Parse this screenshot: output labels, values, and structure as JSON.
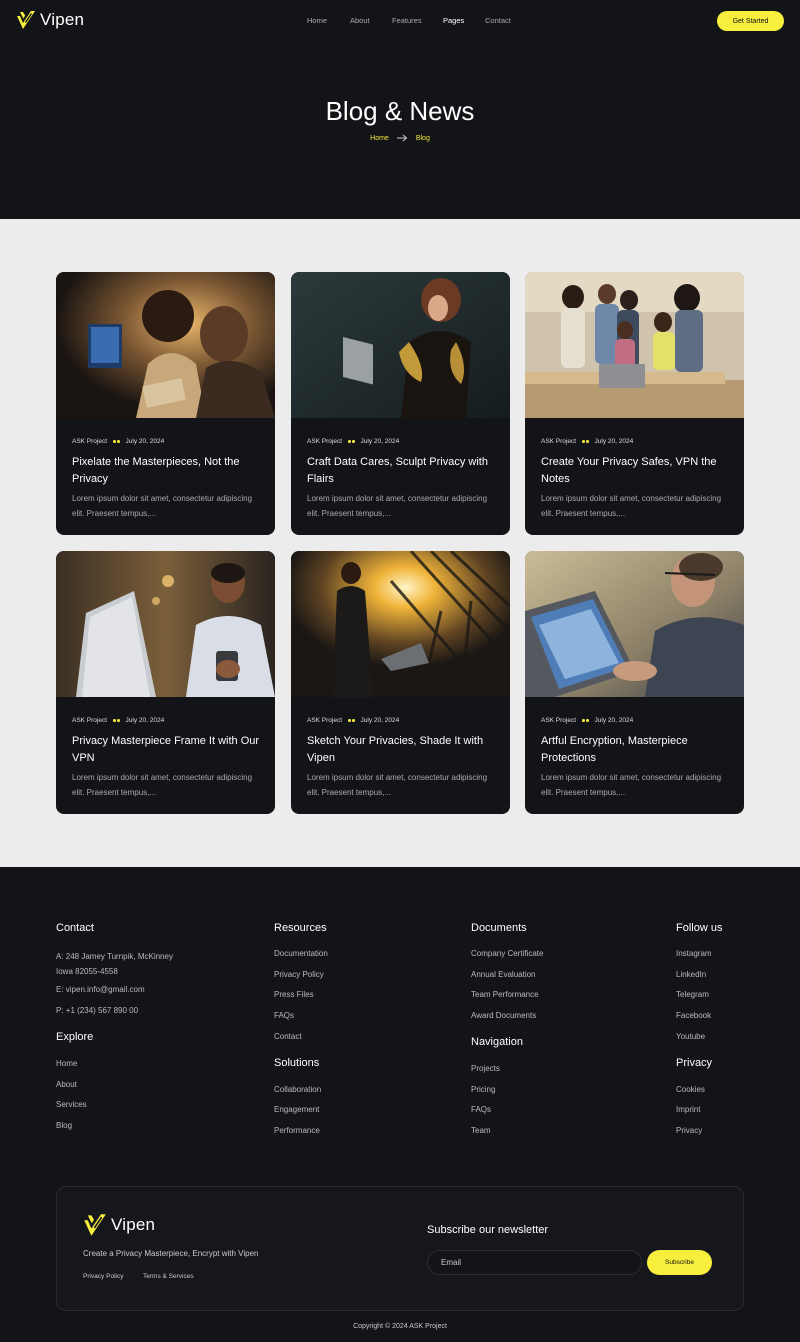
{
  "brand": {
    "name": "Vipen",
    "accent": "#f7ee3e",
    "dark": "#131418"
  },
  "nav": {
    "items": [
      "Home",
      "About",
      "Features",
      "Pages",
      "Contact"
    ],
    "active": "Pages",
    "cta": "Get Started"
  },
  "hero": {
    "title": "Blog & News",
    "breadcrumb": [
      "Home",
      "Blog"
    ]
  },
  "posts": [
    {
      "author": "ASK Project",
      "date": "July 20, 2024",
      "title": "Pixelate the Masterpieces, Not the Privacy",
      "excerpt": "Lorem ipsum dolor sit amet, consectetur adipiscing elit. Praesent tempus,..."
    },
    {
      "author": "ASK Project",
      "date": "July 20, 2024",
      "title": "Craft Data Cares, Sculpt Privacy with Flairs",
      "excerpt": "Lorem ipsum dolor sit amet, consectetur adipiscing elit. Praesent tempus,..."
    },
    {
      "author": "ASK Project",
      "date": "July 20, 2024",
      "title": "Create Your Privacy Safes, VPN the Notes",
      "excerpt": "Lorem ipsum dolor sit amet, consectetur adipiscing elit. Praesent tempus,..."
    },
    {
      "author": "ASK Project",
      "date": "July 20, 2024",
      "title": "Privacy Masterpiece Frame It with Our VPN",
      "excerpt": "Lorem ipsum dolor sit amet, consectetur adipiscing elit. Praesent tempus,..."
    },
    {
      "author": "ASK Project",
      "date": "July 20, 2024",
      "title": "Sketch Your Privacies, Shade It with Vipen",
      "excerpt": "Lorem ipsum dolor sit amet, consectetur adipiscing elit. Praesent tempus,..."
    },
    {
      "author": "ASK Project",
      "date": "July 20, 2024",
      "title": "Artful Encryption, Masterpiece Protections",
      "excerpt": "Lorem ipsum dolor sit amet, consectetur adipiscing elit. Praesent tempus,..."
    }
  ],
  "footer": {
    "contact": {
      "title": "Contact",
      "address_line1": "A: 248 Jamey Turnpik, McKinney",
      "address_line2": "Iowa 82055-4558",
      "email": "E: vipen.info@gmail.com",
      "phone": "P: +1 (234) 567 890 00"
    },
    "explore": {
      "title": "Explore",
      "links": [
        "Home",
        "About",
        "Services",
        "Blog"
      ]
    },
    "resources": {
      "title": "Resources",
      "links": [
        "Documentation",
        "Privacy Policy",
        "Press Files",
        "FAQs",
        "Contact"
      ]
    },
    "solutions": {
      "title": "Solutions",
      "links": [
        "Collaboration",
        "Engagement",
        "Performance"
      ]
    },
    "documents": {
      "title": "Documents",
      "links": [
        "Company Certificate",
        "Annual Evaluation",
        "Team Performance",
        "Award Documents"
      ]
    },
    "navigation": {
      "title": "Navigation",
      "links": [
        "Projects",
        "Pricing",
        "FAQs",
        "Team"
      ]
    },
    "follow": {
      "title": "Follow us",
      "links": [
        "Instagram",
        "LinkedIn",
        "Telegram",
        "Facebook",
        "Youtube"
      ]
    },
    "privacy": {
      "title": "Privacy",
      "links": [
        "Cookies",
        "Imprint",
        "Privacy"
      ]
    },
    "box": {
      "brand": "Vipen",
      "tagline": "Create a Privacy Masterpiece, Encrypt with Vipen",
      "privacy_policy": "Privacy Policy",
      "terms": "Terms & Services",
      "newsletter_title": "Subscribe our newsletter",
      "email_placeholder": "Email",
      "subscribe_label": "Subscribe"
    },
    "copyright": "Copyright © 2024 ASK Project"
  }
}
